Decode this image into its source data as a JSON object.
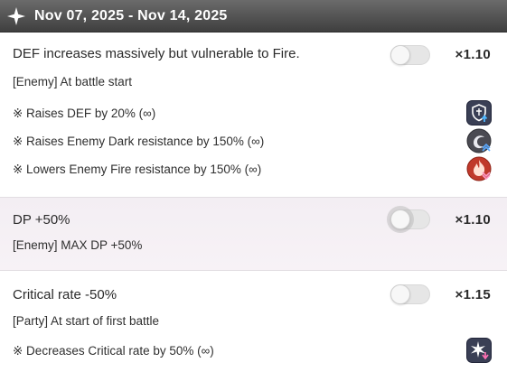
{
  "header": {
    "date_range": "Nov 07, 2025 - Nov 14, 2025",
    "icon": "sparkle-icon"
  },
  "cards": [
    {
      "title": "DEF increases massively but vulnerable to Fire.",
      "target": "[Enemy] At battle start",
      "toggle_on": false,
      "multiplier": "×1.10",
      "effects": [
        {
          "text": "※ Raises DEF by 20% (∞)",
          "icon": "def-up-icon"
        },
        {
          "text": "※ Raises Enemy Dark resistance by 150% (∞)",
          "icon": "dark-resist-up-icon"
        },
        {
          "text": "※ Lowers Enemy Fire resistance by 150% (∞)",
          "icon": "fire-resist-down-icon"
        }
      ]
    },
    {
      "title": "DP +50%",
      "target": "[Enemy] MAX DP +50%",
      "toggle_on": false,
      "multiplier": "×1.10",
      "effects": []
    },
    {
      "title": "Critical rate -50%",
      "target": "[Party] At start of first battle",
      "toggle_on": false,
      "multiplier": "×1.15",
      "effects": [
        {
          "text": "※ Decreases Critical rate by 50% (∞)",
          "icon": "critical-rate-down-icon"
        }
      ]
    }
  ],
  "colors": {
    "header_top": "#6b6b6b",
    "header_bottom": "#3f3f3f",
    "highlight_card": "#f3eef3",
    "fire": "#c0392b",
    "dark": "#3d3d4a"
  }
}
